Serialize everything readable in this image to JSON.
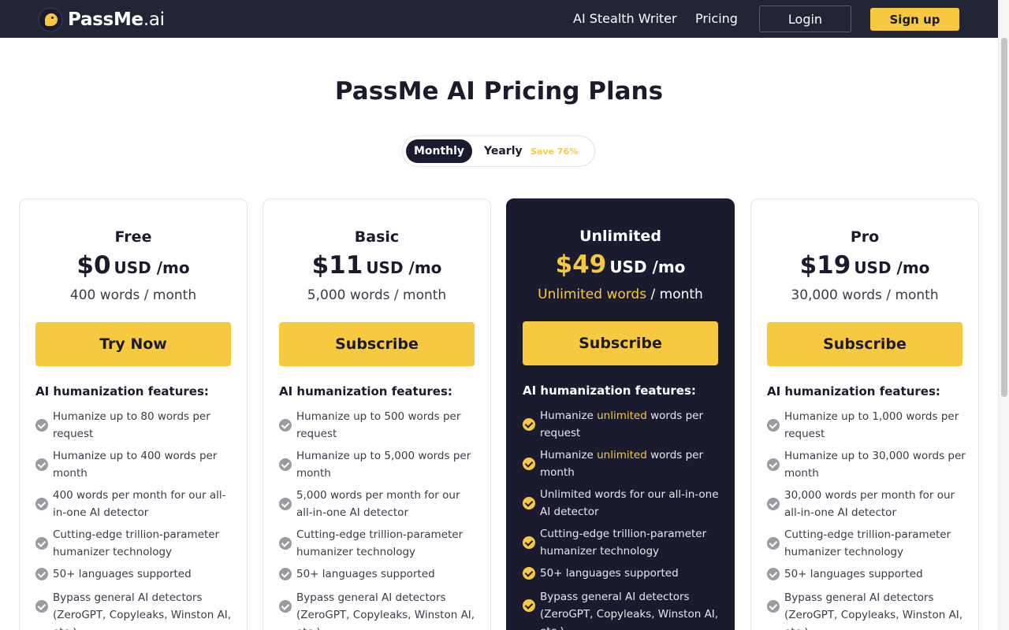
{
  "header": {
    "logo_brand": "PassMe",
    "logo_tld": ".ai",
    "nav": {
      "stealth_writer": "AI Stealth Writer",
      "pricing": "Pricing"
    },
    "login": "Login",
    "signup": "Sign up"
  },
  "page": {
    "title": "PassMe AI Pricing Plans",
    "toggle": {
      "monthly": "Monthly",
      "yearly": "Yearly",
      "save": "Save 76%",
      "selected": "Monthly"
    }
  },
  "colors": {
    "accent": "#f7c940",
    "dark": "#1a1b2e",
    "nav_bg": "#222536"
  },
  "plans": [
    {
      "name": "Free",
      "price": "$0",
      "unit": "USD /mo",
      "words": "400 words / month",
      "cta": "Try Now",
      "features_title": "AI humanization features:",
      "features": [
        "Humanize up to 80 words per request",
        "Humanize up to 400 words per month",
        "400 words per month for our all-in-one AI detector",
        "Cutting-edge trillion-parameter humanizer technology",
        "50+ languages supported",
        "Bypass general AI detectors (ZeroGPT, Copyleaks, Winston AI, etc.)"
      ]
    },
    {
      "name": "Basic",
      "price": "$11",
      "unit": "USD /mo",
      "words": "5,000 words / month",
      "cta": "Subscribe",
      "features_title": "AI humanization features:",
      "features": [
        "Humanize up to 500 words per request",
        "Humanize up to 5,000 words per month",
        "5,000 words per month for our all-in-one AI detector",
        "Cutting-edge trillion-parameter humanizer technology",
        "50+ languages supported",
        "Bypass general AI detectors (ZeroGPT, Copyleaks, Winston AI, etc.)"
      ]
    },
    {
      "name": "Unlimited",
      "price": "$49",
      "unit": "USD /mo",
      "words_highlight": "Unlimited words",
      "words_rest": " / month",
      "cta": "Subscribe",
      "features_title": "AI humanization features:",
      "features": [
        {
          "before": "Humanize ",
          "highlight": "unlimited",
          "after": " words per request"
        },
        {
          "before": "Humanize ",
          "highlight": "unlimited",
          "after": " words per month"
        },
        {
          "text": "Unlimited words for our all-in-one AI detector"
        },
        {
          "text": "Cutting-edge trillion-parameter humanizer technology"
        },
        {
          "text": "50+ languages supported"
        },
        {
          "text": "Bypass general AI detectors (ZeroGPT, Copyleaks, Winston AI, etc.)"
        }
      ]
    },
    {
      "name": "Pro",
      "price": "$19",
      "unit": "USD /mo",
      "words": "30,000 words / month",
      "cta": "Subscribe",
      "features_title": "AI humanization features:",
      "features": [
        "Humanize up to 1,000 words per request",
        "Humanize up to 30,000 words per month",
        "30,000 words per month for our all-in-one AI detector",
        "Cutting-edge trillion-parameter humanizer technology",
        "50+ languages supported",
        "Bypass general AI detectors (ZeroGPT, Copyleaks, Winston AI, etc.)"
      ]
    }
  ]
}
